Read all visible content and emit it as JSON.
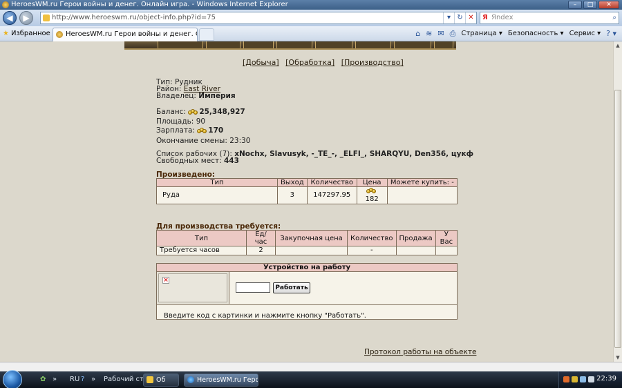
{
  "window": {
    "title": "HeroesWM.ru Герои войны и денег. Онлайн игра. - Windows Internet Explorer",
    "min": "–",
    "max": "□",
    "close": "✕"
  },
  "nav": {
    "back": "◀",
    "forward": "▶",
    "address": "http://www.heroeswm.ru/object-info.php?id=75",
    "search_placeholder": "Яndex",
    "search_logo": "Я"
  },
  "tabs": {
    "favorites": "Избранное",
    "active_tab": "HeroesWM.ru Герои войны и денег. Онлайн игр...",
    "commands": {
      "page": "Страница ▾",
      "safety": "Безопасность ▾",
      "tools": "Сервис ▾",
      "help": "? ▾"
    }
  },
  "page": {
    "links": [
      "[Добыча]",
      "[Обработка]",
      "[Производство]"
    ],
    "type_label": "Тип:",
    "type_value": "Рудник",
    "district_label": "Район:",
    "district_value": "East River",
    "owner_label": "Владелец:",
    "owner_value": "Империя",
    "balance_label": "Баланс:",
    "balance_value": "25,348,927",
    "area_label": "Площадь:",
    "area_value": "90",
    "salary_label": "Зарплата:",
    "salary_value": "170",
    "shift_end_label": "Окончание смены:",
    "shift_end_value": "23:30",
    "workers_label": "Список рабочих (7):",
    "workers_value": "xNochx, Slavusyk, -_TE_-, _ELFI_, SHARQYU, Den356, цукф",
    "free_label": "Свободных мест:",
    "free_value": "443",
    "produced_title": "Произведено:",
    "produced_table": {
      "headers": [
        "Тип",
        "Выход",
        "Количество",
        "Цена",
        "Можете купить: -"
      ],
      "rows": [
        [
          "Руда",
          "3",
          "147297.95",
          "182",
          ""
        ]
      ]
    },
    "required_title": "Для производства требуется:",
    "required_table": {
      "headers": [
        "Тип",
        "Ед/час",
        "Закупочная цена",
        "Количество",
        "Продажа",
        "У Вас"
      ],
      "rows": [
        [
          "Требуется часов",
          "2",
          "",
          "-",
          "",
          ""
        ]
      ]
    },
    "job_title": "Устройство на работу",
    "job_button": "Работать",
    "job_hint": "Введите код с картинки и нажмите кнопку \"Работать\".",
    "protocol_link": "Протокол работы на объекте"
  },
  "taskbar": {
    "lang": "RU",
    "desktop": "Рабочий стол",
    "folder_btn": "Об",
    "ie_btn": "HeroesWM.ru Геро...",
    "clock": "22:39"
  }
}
